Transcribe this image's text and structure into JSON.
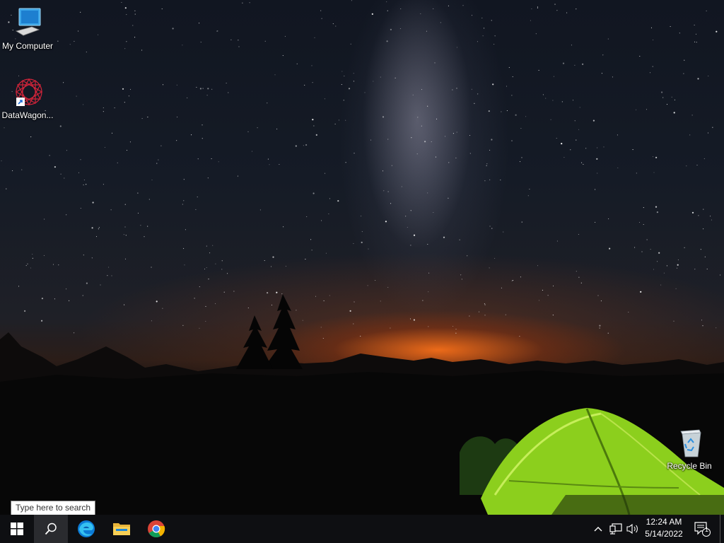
{
  "desktop": {
    "icons": [
      {
        "label": "My Computer",
        "icon": "monitor-icon"
      },
      {
        "label": "DataWagon...",
        "icon": "datawagon-logo-icon"
      },
      {
        "label": "Recycle Bin",
        "icon": "recycle-bin-icon"
      }
    ]
  },
  "search": {
    "placeholder": "Type here to search"
  },
  "taskbar": {
    "buttons": [
      {
        "name": "Start",
        "icon": "windows-logo-icon"
      },
      {
        "name": "Search",
        "icon": "search-icon"
      },
      {
        "name": "Microsoft Edge",
        "icon": "edge-icon"
      },
      {
        "name": "File Explorer",
        "icon": "folder-icon"
      },
      {
        "name": "Google Chrome",
        "icon": "chrome-icon"
      }
    ],
    "tray": {
      "icons": [
        "chevron-up-icon",
        "network-icon",
        "volume-icon"
      ],
      "time": "12:24 AM",
      "date": "5/14/2022",
      "notifications": "1"
    }
  },
  "colors": {
    "taskbar": "#0e0f12",
    "edge_blue": "#0c7bd6",
    "tent_green": "#8ccf1d",
    "sunset": "#f06a19"
  }
}
